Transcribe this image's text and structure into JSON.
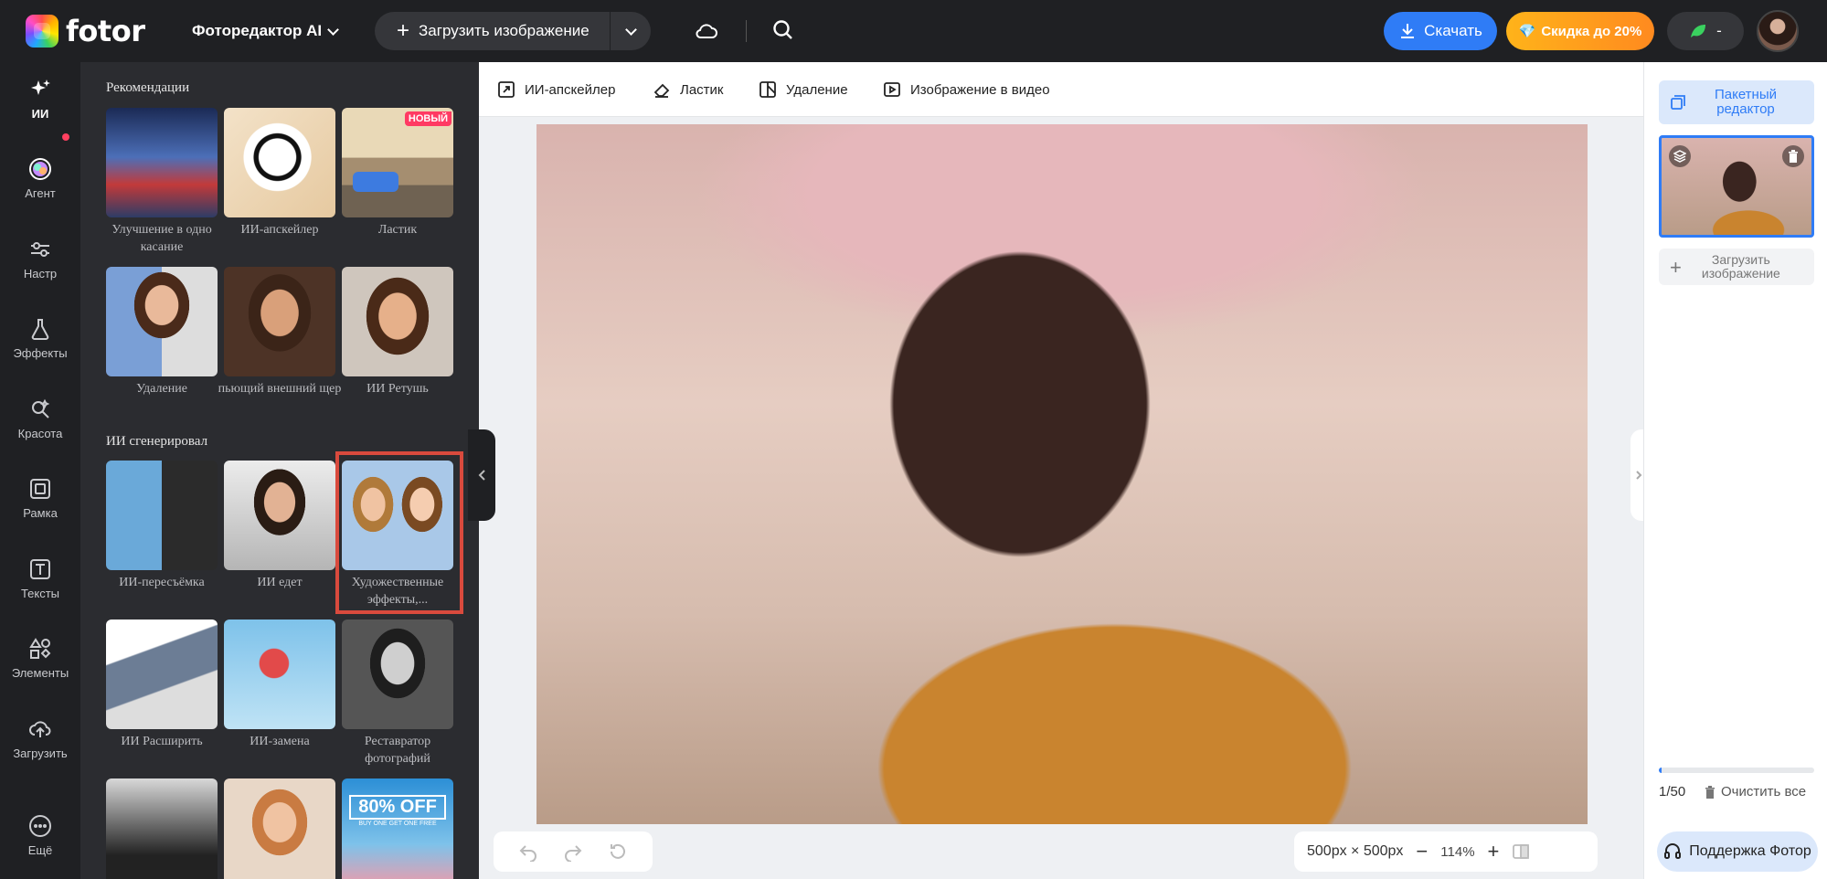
{
  "topbar": {
    "logo": "fotor",
    "editor_menu": "Фоторедактор AI",
    "upload": "Загрузить изображение",
    "download": "Скачать",
    "discount": "Скидка до 20%",
    "credits": "-"
  },
  "rail": [
    {
      "label": "ИИ",
      "icon": "sparkle-icon"
    },
    {
      "label": "Агент",
      "icon": "agent-orb-icon"
    },
    {
      "label": "Настр",
      "icon": "sliders-icon"
    },
    {
      "label": "Эффекты",
      "icon": "flask-icon"
    },
    {
      "label": "Красота",
      "icon": "beauty-icon"
    },
    {
      "label": "Рамка",
      "icon": "frame-icon"
    },
    {
      "label": "Тексты",
      "icon": "text-icon"
    },
    {
      "label": "Элементы",
      "icon": "elements-icon"
    },
    {
      "label": "Загрузить",
      "icon": "cloud-upload-icon"
    },
    {
      "label": "Ещё",
      "icon": "more-icon"
    }
  ],
  "panel": {
    "section_recommend": "Рекомендации",
    "section_generated": "ИИ сгенерировал",
    "badge_new": "НОВЫЙ",
    "tools": [
      {
        "label": "Улучшение в одно касание"
      },
      {
        "label": "ИИ-апскейлер"
      },
      {
        "label": "Ластик"
      },
      {
        "label": "Удаление"
      },
      {
        "label": "пьющий внешний щер"
      },
      {
        "label": "ИИ Ретушь"
      },
      {
        "label": "ИИ-пересъёмка"
      },
      {
        "label": "ИИ едет"
      },
      {
        "label": "Художественные эффекты,..."
      },
      {
        "label": "ИИ Расширить"
      },
      {
        "label": "ИИ-замена"
      },
      {
        "label": "Реставратор фотографий"
      }
    ],
    "promo_text": "80% OFF",
    "promo_sub": "BUY ONE GET ONE FREE"
  },
  "subbar": [
    {
      "label": "ИИ-апскейлер",
      "icon": "upscale-icon"
    },
    {
      "label": "Ластик",
      "icon": "eraser-icon"
    },
    {
      "label": "Удаление",
      "icon": "remove-bg-icon"
    },
    {
      "label": "Изображение в видео",
      "icon": "video-icon"
    }
  ],
  "canvas": {
    "size": "500px × 500px",
    "zoom": "114%"
  },
  "right": {
    "batch": "Пакетный редактор",
    "upload": "Загрузить изображение",
    "count": "1/50",
    "count_progress": 0.02,
    "clear": "Очистить все",
    "support": "Поддержка Фотор"
  },
  "colors": {
    "accent": "#2f7cf6",
    "dark_bg": "#1f2023",
    "panel_bg": "#2b2c30",
    "selection": "#d94a3d",
    "discount_from": "#ffb31a",
    "discount_to": "#ff8a1f"
  }
}
